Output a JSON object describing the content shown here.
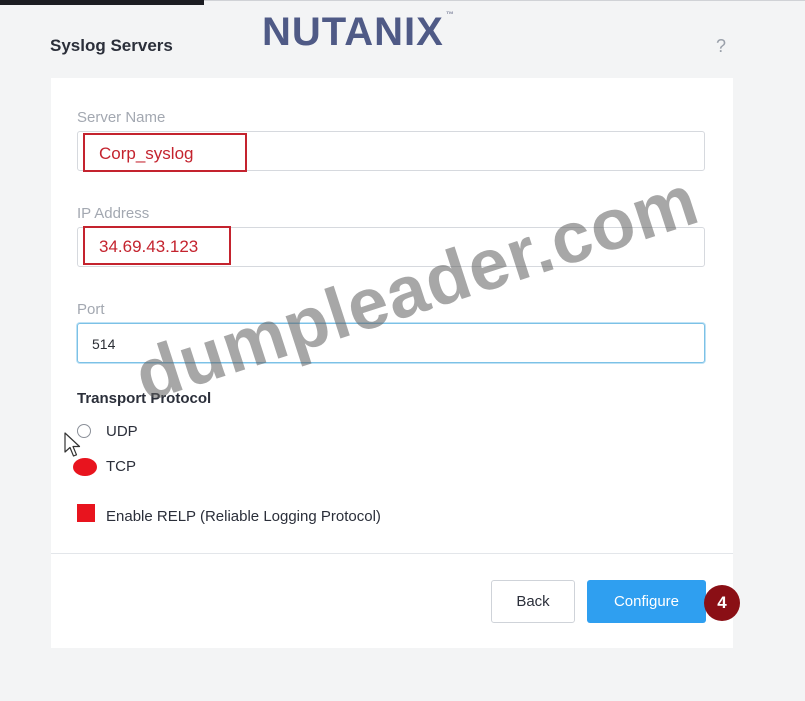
{
  "brand": {
    "logo_text": "NUTANIX",
    "tm": "™"
  },
  "dialog": {
    "title": "Syslog Servers",
    "help": "?"
  },
  "form": {
    "server_name": {
      "label": "Server Name",
      "value": "Corp_syslog"
    },
    "ip_address": {
      "label": "IP Address",
      "value": "34.69.43.123"
    },
    "port": {
      "label": "Port",
      "value": "514"
    },
    "transport": {
      "title": "Transport Protocol",
      "options": [
        "UDP",
        "TCP"
      ],
      "selected": "TCP"
    },
    "relp": {
      "label": "Enable RELP (Reliable Logging Protocol)",
      "checked": true
    }
  },
  "buttons": {
    "back": "Back",
    "configure": "Configure"
  },
  "annotation": {
    "step": "4"
  },
  "watermark": "dumpleader.com",
  "colors": {
    "accent": "#2f9ff0",
    "highlight": "#e8141e",
    "step_badge": "#8a0f15"
  }
}
